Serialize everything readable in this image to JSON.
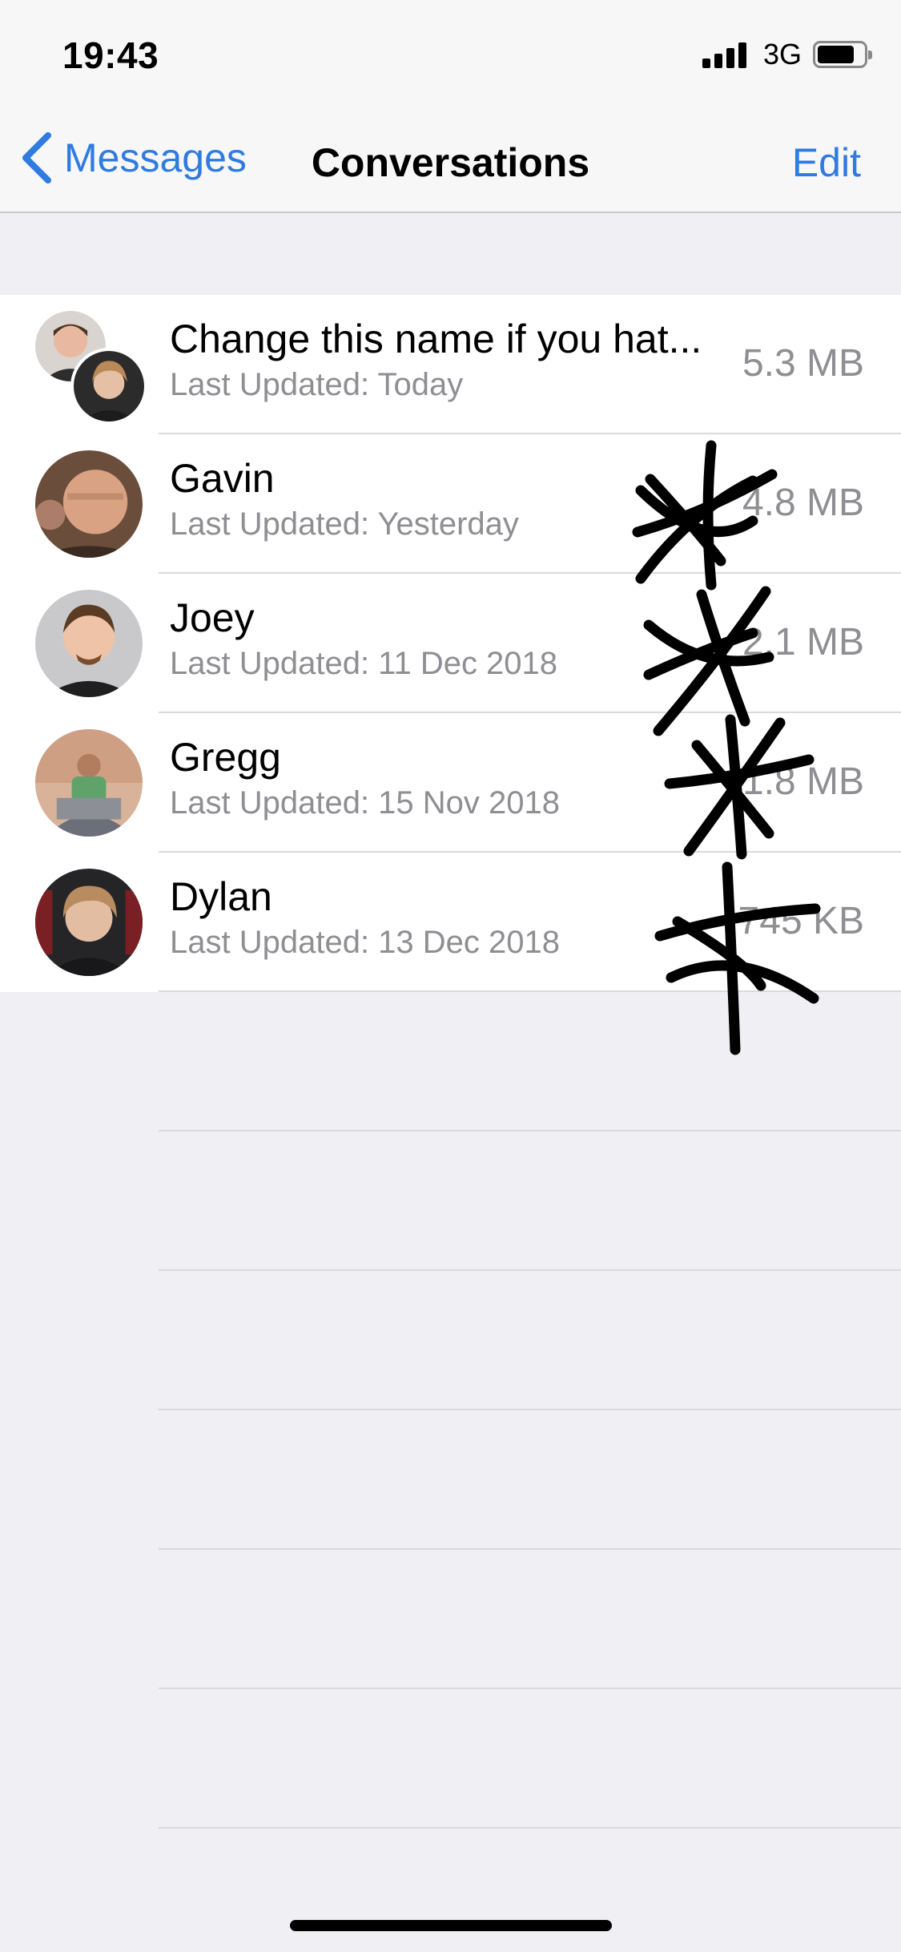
{
  "status_bar": {
    "time": "19:43",
    "network": "3G",
    "battery_level": 0.8
  },
  "nav": {
    "back_label": "Messages",
    "title": "Conversations",
    "edit_label": "Edit"
  },
  "conversations": [
    {
      "name": "Change this name if you hat...",
      "updated": "Last Updated: Today",
      "size": "5.3 MB"
    },
    {
      "name": "Gavin",
      "updated": "Last Updated: Yesterday",
      "size": "4.8 MB"
    },
    {
      "name": "Joey",
      "updated": "Last Updated: 11 Dec 2018",
      "size": "2.1 MB"
    },
    {
      "name": "Gregg",
      "updated": "Last Updated: 15 Nov 2018",
      "size": "1.8 MB"
    },
    {
      "name": "Dylan",
      "updated": "Last Updated: 13 Dec 2018",
      "size": "745 KB"
    }
  ],
  "colors": {
    "accent": "#2f7bdf",
    "background": "#efeff4",
    "secondary_text": "#8e8e93"
  }
}
